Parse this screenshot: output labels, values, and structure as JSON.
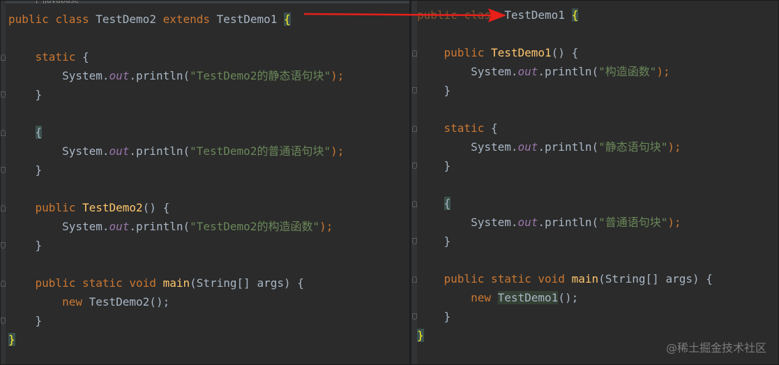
{
  "left_editor": {
    "tab_label": "javabase",
    "code": {
      "class_decl": {
        "kw1": "public",
        "kw2": "class",
        "name": "TestDemo2",
        "kw3": "extends",
        "parent": "TestDemo1",
        "brace": "{"
      },
      "static_kw": "static",
      "open_brace": "{",
      "close_brace": "}",
      "sys1": "System.",
      "out": "out",
      "println": ".println(",
      "str_static": "\"TestDemo2的静态语句块\"",
      "end": ");",
      "str_instance": "\"TestDemo2的普通语句块\"",
      "ctor_kw": "public",
      "ctor_name": "TestDemo2",
      "ctor_parens": "() {",
      "str_ctor": "\"TestDemo2的构造函数\"",
      "main_kw1": "public",
      "main_kw2": "static",
      "main_kw3": "void",
      "main_name": "main",
      "main_params": "(String[] args) {",
      "new_kw": "new",
      "new_expr": "TestDemo2();",
      "final_brace": "}"
    }
  },
  "right_editor": {
    "code": {
      "class_decl_hidden": "public class ",
      "class_name": "TestDemo1",
      "brace": "{",
      "ctor_kw": "public",
      "ctor_name": "TestDemo1",
      "ctor_parens": "() {",
      "sys": "System.",
      "out": "out",
      "println": ".println(",
      "end": ");",
      "str_ctor": "\"构造函数\"",
      "static_kw": "static",
      "str_static": "\"静态语句块\"",
      "str_instance": "\"普通语句块\"",
      "main_kw1": "public",
      "main_kw2": "static",
      "main_kw3": "void",
      "main_name": "main",
      "main_params": "(String[] args) {",
      "new_kw": "new",
      "new_name": "TestDemo1",
      "new_tail": "();",
      "open_brace": "{",
      "close_brace": "}",
      "final_brace": "}"
    }
  },
  "watermark": "@稀土掘金技术社区",
  "colors": {
    "background": "#2b2b2b",
    "keyword": "#cc7832",
    "string": "#6a8759",
    "field": "#9876aa",
    "method": "#ffc66d",
    "arrow": "#e8201a"
  }
}
